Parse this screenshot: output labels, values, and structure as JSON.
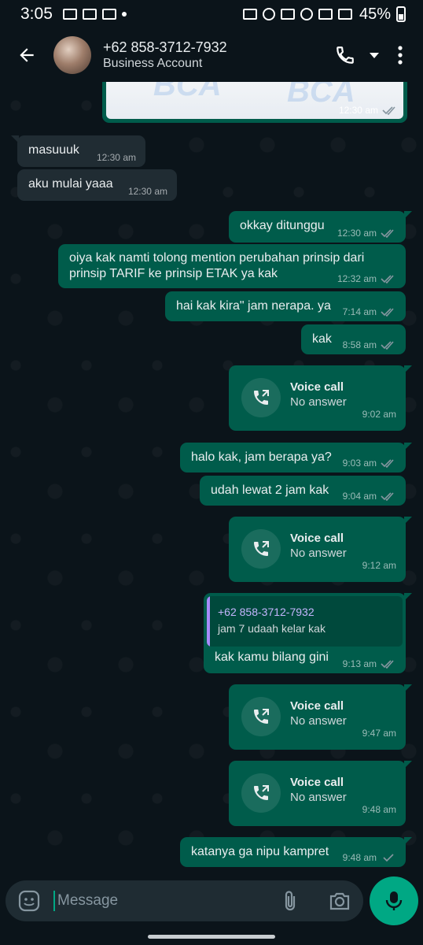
{
  "status_bar": {
    "time": "3:05",
    "battery": "45%"
  },
  "header": {
    "contact_name": "+62 858-3712-7932",
    "subtitle": "Business Account"
  },
  "image_message": {
    "time": "12:30 am",
    "watermark": "BCA"
  },
  "messages": [
    {
      "text": "masuuuk",
      "time": "12:30 am"
    },
    {
      "text": "aku mulai yaaa",
      "time": "12:30 am"
    },
    {
      "text": "okkay ditunggu",
      "time": "12:30 am"
    },
    {
      "text": "oiya kak namti tolong mention perubahan prinsip dari",
      "text2": "prinsip TARIF ke prinsip ETAK ya kak",
      "time": "12:32 am"
    },
    {
      "text": "hai kak kira\" jam nerapa. ya",
      "time": "7:14 am"
    },
    {
      "text": "kak",
      "time": "8:58 am"
    },
    {
      "title": "Voice call",
      "subtitle": "No answer",
      "time": "9:02 am"
    },
    {
      "text": "halo kak, jam berapa ya?",
      "time": "9:03 am"
    },
    {
      "text": "udah lewat 2 jam kak",
      "time": "9:04 am"
    },
    {
      "title": "Voice call",
      "subtitle": "No answer",
      "time": "9:12 am"
    },
    {
      "quote_name": "+62 858-3712-7932",
      "quote_text": "jam 7 udaah kelar kak",
      "text": "kak kamu bilang gini",
      "time": "9:13 am"
    },
    {
      "title": "Voice call",
      "subtitle": "No answer",
      "time": "9:47 am"
    },
    {
      "title": "Voice call",
      "subtitle": "No answer",
      "time": "9:48 am"
    },
    {
      "text": "katanya ga nipu kampret",
      "time": "9:48 am"
    }
  ],
  "composer": {
    "placeholder": "Message"
  },
  "colors": {
    "background": "#0b141a",
    "incoming_bubble": "#202c33",
    "outgoing_bubble": "#005c4b",
    "accent": "#00a884",
    "read_ticks": "#8696a0"
  },
  "icons": {
    "back": "arrow-left-icon",
    "call": "phone-icon",
    "dropdown": "chevron-down-icon",
    "menu": "more-vert-icon",
    "emoji": "sticker-icon",
    "attach": "paperclip-icon",
    "camera": "camera-icon",
    "mic": "mic-icon",
    "voice_call": "outgoing-call-icon",
    "ticks": "double-check-icon"
  }
}
